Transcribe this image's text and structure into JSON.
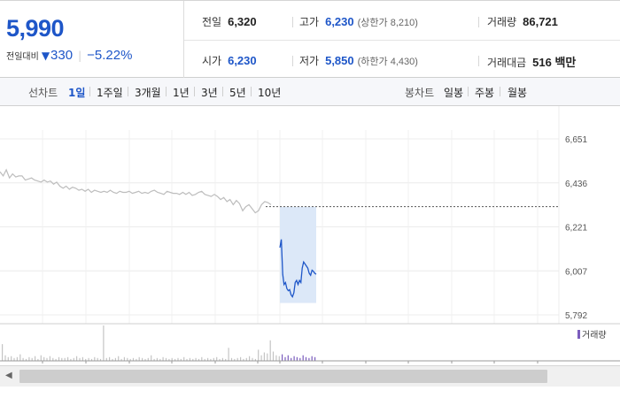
{
  "summary": {
    "price": "5,990",
    "change_label": "전일대비",
    "change_arrow": "▼",
    "change_value": "330",
    "change_separator": "|",
    "change_pct": "−5.22%",
    "prev_close_label": "전일",
    "prev_close": "6,320",
    "high_label": "고가",
    "high": "6,230",
    "upper_limit": "(상한가 8,210)",
    "volume_label": "거래량",
    "volume": "86,721",
    "open_label": "시가",
    "open": "6,230",
    "low_label": "저가",
    "low": "5,850",
    "lower_limit": "(하한가 4,430)",
    "trade_value_label": "거래대금",
    "trade_value": "516 백만"
  },
  "toolbar": {
    "line_chart_label": "선차트",
    "periods": [
      "1일",
      "1주일",
      "3개월",
      "1년",
      "3년",
      "5년",
      "10년"
    ],
    "active_period": "1일",
    "candle_chart_label": "봉차트",
    "candle_periods": [
      "일봉",
      "주봉",
      "월봉"
    ]
  },
  "colors": {
    "accent": "#1e56c8",
    "line_prev": "#bdbdbd",
    "highlight": "#dce8f8",
    "volume": "#7b5dbd"
  },
  "icons": {
    "scroll_left": "arrow-left-icon"
  },
  "chart_data": {
    "type": "line",
    "ylim": [
      5792,
      6651
    ],
    "yticks": [
      "6,651",
      "6,436",
      "6,221",
      "6,007",
      "5,792"
    ],
    "prev_close": 6320,
    "legend": "거래량",
    "series": [
      {
        "values": [
          6490,
          6470,
          6500,
          6460,
          6480,
          6465,
          6470,
          6470,
          6450,
          6455,
          6460,
          6450,
          6445,
          6440,
          6450,
          6440,
          6445,
          6430,
          6440,
          6420,
          6410,
          6420,
          6405,
          6415,
          6410,
          6400,
          6405,
          6395,
          6405,
          6390,
          6400,
          6395,
          6390,
          6395,
          6390,
          6400,
          6390,
          6385,
          6395,
          6390,
          6390,
          6395,
          6385,
          6390,
          6395,
          6385,
          6390,
          6385,
          6395,
          6400,
          6390,
          6385,
          6380,
          6395,
          6390,
          6385,
          6385,
          6380,
          6390,
          6380,
          6390,
          6375,
          6380,
          6390,
          6395,
          6380,
          6375,
          6370,
          6380,
          6370,
          6355,
          6365,
          6345,
          6355,
          6330,
          6350,
          6335,
          6300,
          6320,
          6330,
          6310,
          6290,
          6300,
          6330,
          6345,
          6340,
          6330
        ]
      },
      {
        "values": [
          6120,
          6160,
          5990,
          5940,
          5950,
          5920,
          5910,
          5915,
          5890,
          5880,
          5900,
          5950,
          5960,
          5940,
          5960,
          5950,
          6020,
          6050,
          6040,
          6030,
          6020,
          5995,
          5985,
          6010,
          6005,
          5995,
          5990
        ]
      }
    ],
    "volume": [
      18,
      6,
      4,
      5,
      3,
      4,
      7,
      3,
      2,
      4,
      3,
      5,
      2,
      6,
      4,
      3,
      5,
      3,
      2,
      4,
      3,
      3,
      4,
      2,
      3,
      5,
      3,
      4,
      2,
      3,
      2,
      4,
      3,
      2,
      38,
      3,
      4,
      2,
      3,
      5,
      2,
      4,
      3,
      2,
      3,
      2,
      4,
      3,
      2,
      3,
      6,
      2,
      3,
      2,
      4,
      3,
      2,
      3,
      2,
      3,
      2,
      4,
      2,
      3,
      2,
      3,
      2,
      4,
      2,
      3,
      2,
      3,
      4,
      2,
      3,
      2,
      14,
      3,
      2,
      3,
      4,
      2,
      3,
      5,
      3,
      2,
      12,
      6,
      9,
      8,
      22,
      10,
      6,
      5,
      7,
      4,
      6,
      3,
      5,
      4,
      3,
      6,
      4,
      3,
      5,
      4
    ]
  }
}
